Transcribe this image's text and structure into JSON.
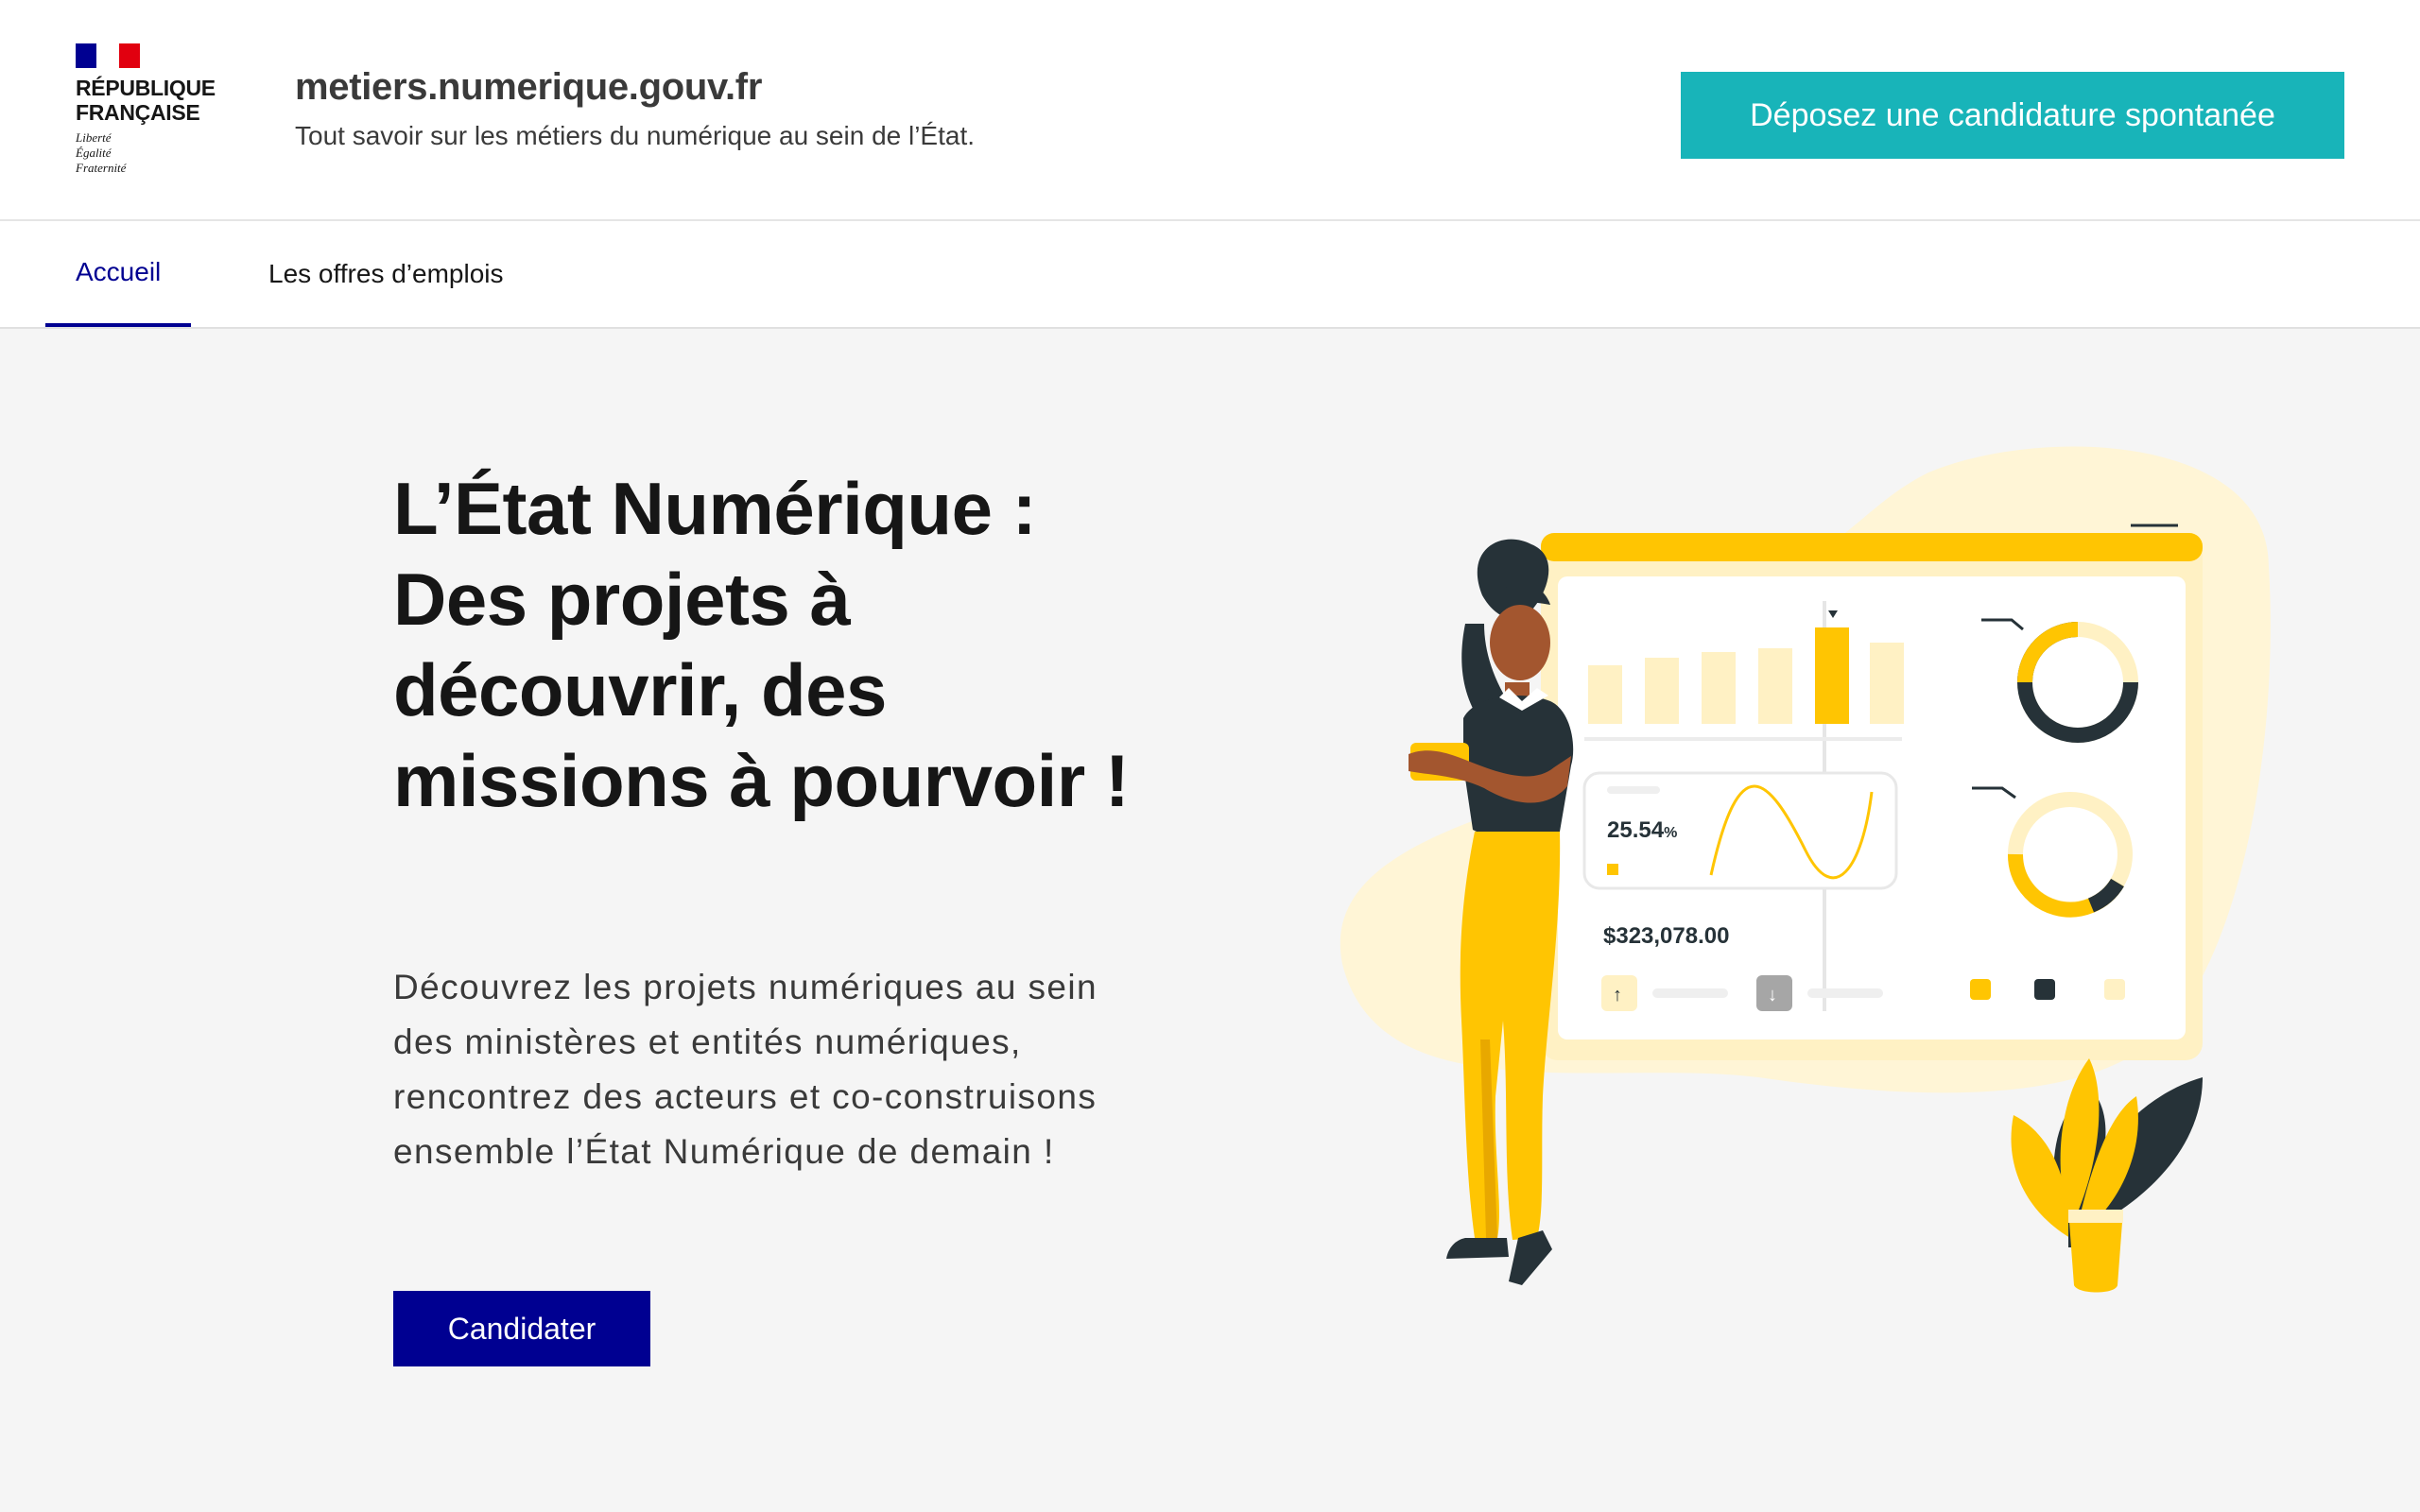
{
  "header": {
    "logo": {
      "republic_name": "RÉPUBLIQUE FRANÇAISE",
      "motto": [
        "Liberté",
        "Égalité",
        "Fraternité"
      ],
      "icon": "marianne-flag-icon"
    },
    "site_title": "metiers.numerique.gouv.fr",
    "tagline": "Tout savoir sur les métiers du numérique au sein de l’État.",
    "cta_label": "Déposez une candidature spontanée"
  },
  "nav": {
    "tabs": [
      {
        "label": "Accueil",
        "active": true
      },
      {
        "label": "Les offres d’emplois",
        "active": false
      }
    ]
  },
  "hero": {
    "title": "L’État Numérique : Des projets à découvrir, des missions à pourvoir !",
    "description": "Découvrez les projets numériques au sein des ministères et entités numériques, rencontrez des acteurs et co-construisons ensemble l’État Numérique de demain !",
    "cta_label": "Candidater"
  },
  "illustration": {
    "percent_value": "25.54",
    "percent_unit": "%",
    "amount": "$323,078.00",
    "colors": {
      "accent_yellow": "#ffc502",
      "light_yellow": "#fff1c4",
      "dark": "#263238"
    }
  },
  "colors": {
    "primary_blue": "#000091",
    "teal_button": "#18b4b9",
    "background": "#f5f5f5"
  }
}
